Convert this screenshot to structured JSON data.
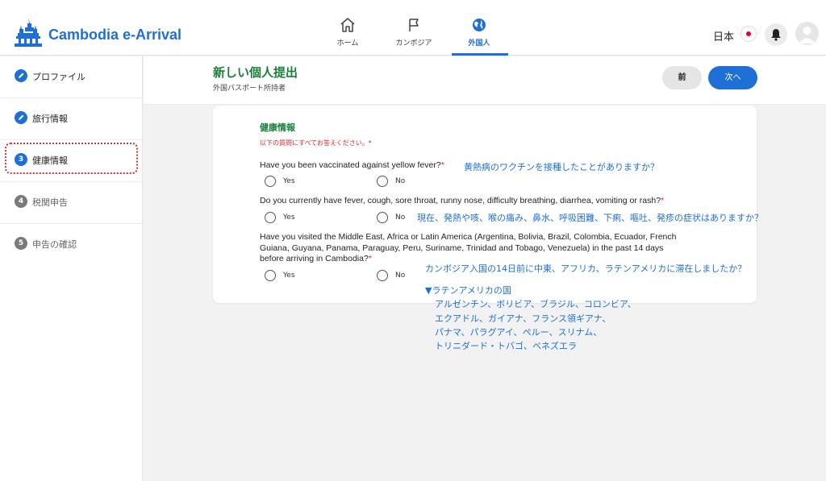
{
  "header": {
    "brand": "Cambodia e-Arrival",
    "nav": [
      {
        "label": "ホーム",
        "icon": "home-icon"
      },
      {
        "label": "カンボジア",
        "icon": "flag-icon"
      },
      {
        "label": "外国人",
        "icon": "globe-icon",
        "active": true
      }
    ],
    "language": "日本",
    "accent_color": "#1e6fd6"
  },
  "sidebar": {
    "steps": [
      {
        "label": "プロファイル",
        "status": "done"
      },
      {
        "label": "旅行情報",
        "status": "done"
      },
      {
        "number": "3",
        "label": "健康情報",
        "status": "active"
      },
      {
        "number": "4",
        "label": "税関申告",
        "status": "pending"
      },
      {
        "number": "5",
        "label": "申告の確認",
        "status": "pending"
      }
    ]
  },
  "page": {
    "title": "新しい個人提出",
    "subtitle": "外国パスポート所持者",
    "prev_label": "前",
    "next_label": "次へ",
    "title_color": "#1a7f3b"
  },
  "form": {
    "section_title": "健康情報",
    "instruction": "以下の質問にすべてお答えください。*",
    "questions": [
      {
        "text": "Have you been vaccinated against yellow fever?",
        "required": "*",
        "options": [
          "Yes",
          "No"
        ]
      },
      {
        "text": "Do you currently have fever, cough,  sore throat, runny nose, difficulty breathing, diarrhea, vomiting or rash?",
        "required": "*",
        "options": [
          "Yes",
          "No"
        ]
      },
      {
        "text_lines": [
          "Have you visited the Middle East, Africa or Latin America (Argentina, Bolivia, Brazil, Colombia, Ecuador, French",
          "Guiana, Guyana, Panama, Paraguay, Peru, Suriname, Trinidad and Tobago, Venezuela) in the past 14 days",
          "before arriving in Cambodia?"
        ],
        "required": "*",
        "options": [
          "Yes",
          "No"
        ]
      }
    ]
  },
  "annotations": {
    "q1": "黄熱病のワクチンを接種したことがありますか？",
    "q2": "現在、発熱や咳、喉の痛み、鼻水、呼吸困難、下痢、嘔吐、発疹の症状はありますか？",
    "q3": "カンボジア入国の14日前に中東、アフリカ、ラテンアメリカに滞在しましたか？",
    "latam_heading": "▼ラテンアメリカの国",
    "latam_lines": [
      "アルゼンチン、ボリビア、ブラジル、コロンビア、",
      "エクアドル、ガイアナ、フランス領ギアナ、",
      "パナマ、パラグアイ、ペルー、スリナム、",
      "トリニダード・トバゴ、ベネズエラ"
    ]
  }
}
